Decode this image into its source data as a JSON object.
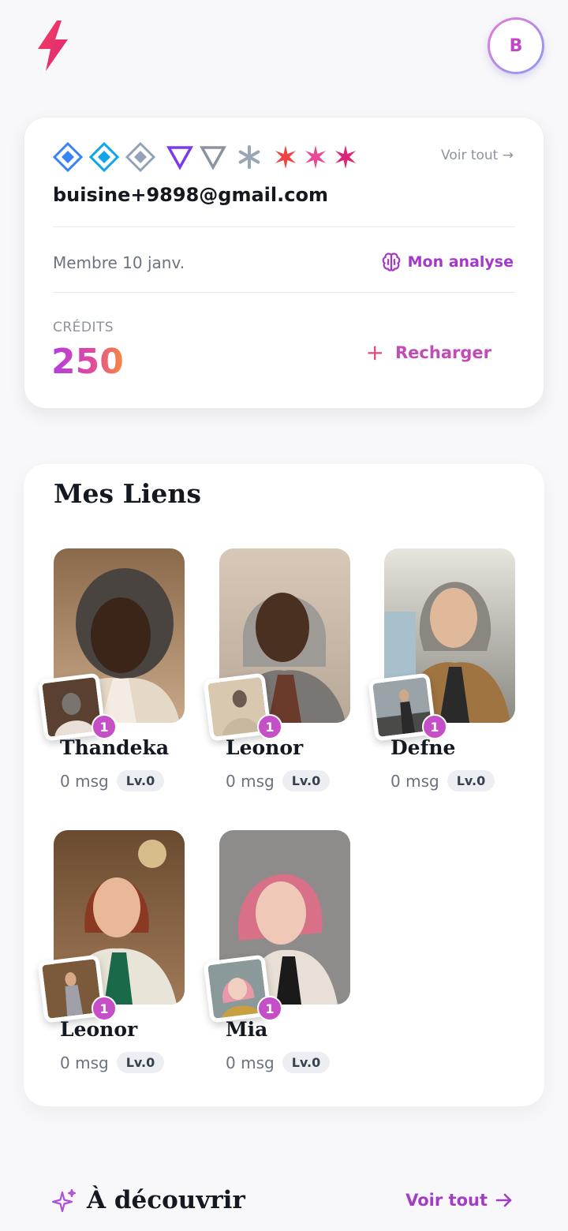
{
  "header": {
    "avatar_initial": "B",
    "logo_icon": "lightning-bolt-icon",
    "accent": "#e92f6a"
  },
  "account": {
    "voir_tout": "Voir tout →",
    "email": "buisine+9898@gmail.com",
    "member_since": "Membre 10 janv.",
    "analyse_label": "Mon analyse",
    "analyse_icon": "brain-icon",
    "credits_label": "CRÉDITS",
    "credits_value": "250",
    "recharge_plus": "+",
    "recharge_label": "Recharger",
    "badge_colors": [
      "#3b82f6",
      "#0ea5e9",
      "#94a3b8",
      "#7c3aed",
      "#8b93a3",
      "#9aa6b8",
      "#ef4444",
      "#ec4899",
      "#db2777"
    ]
  },
  "links": {
    "title": "Mes Liens",
    "profiles": [
      {
        "name": "Thandeka",
        "count": "1",
        "msgs": "0 msg",
        "level": "Lv.0"
      },
      {
        "name": "Leonor",
        "count": "1",
        "msgs": "0 msg",
        "level": "Lv.0"
      },
      {
        "name": "Defne",
        "count": "1",
        "msgs": "0 msg",
        "level": "Lv.0"
      },
      {
        "name": "Leonor",
        "count": "1",
        "msgs": "0 msg",
        "level": "Lv.0"
      },
      {
        "name": "Mia",
        "count": "1",
        "msgs": "0 msg",
        "level": "Lv.0"
      }
    ]
  },
  "discover": {
    "title": "À découvrir",
    "icon": "sparkle-icon",
    "link_label": "Voir tout"
  }
}
